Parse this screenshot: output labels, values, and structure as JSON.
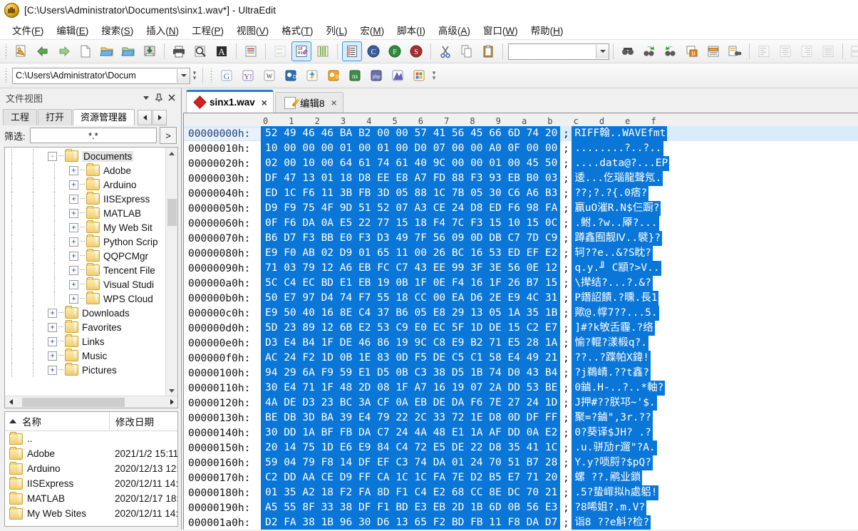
{
  "window": {
    "title": "[C:\\Users\\Administrator\\Documents\\sinx1.wav*] - UltraEdit",
    "app_icon": "ultraedit-icon"
  },
  "menubar": [
    {
      "label": "文件(F)"
    },
    {
      "label": "编辑(E)"
    },
    {
      "label": "搜索(S)"
    },
    {
      "label": "插入(N)"
    },
    {
      "label": "工程(P)"
    },
    {
      "label": "视图(V)"
    },
    {
      "label": "格式(T)"
    },
    {
      "label": "列(L)"
    },
    {
      "label": "宏(M)"
    },
    {
      "label": "脚本(I)"
    },
    {
      "label": "高级(A)"
    },
    {
      "label": "窗口(W)"
    },
    {
      "label": "帮助(H)"
    }
  ],
  "toolbar": {
    "path_combo_value": "C:\\Users\\Administrator\\Docum",
    "icons": [
      "open-recent-icon",
      "back-arrow-icon",
      "forward-arrow-icon",
      "new-file-icon",
      "open-folder-icon",
      "open-project-icon",
      "save-icon",
      "print-icon",
      "print-preview-icon",
      "font-icon",
      "wordwrap-icon",
      "indent-icon",
      "hex-edit-icon",
      "column-mode-icon",
      "list-lines-icon",
      "uc-icon",
      "uf-icon",
      "us-icon",
      "cut-icon",
      "copy-icon",
      "paste-icon",
      "find-icon",
      "find-prev-icon",
      "find-next-icon",
      "bookmark-icon",
      "highlight-icon",
      "find-in-files-icon",
      "align-left-icon",
      "align-center-icon",
      "align-right-icon",
      "justify-icon",
      "compare-icon",
      "split-window-icon",
      "cascade-icon"
    ],
    "web_icons": [
      "google-icon",
      "yahoo-icon",
      "wikipedia-icon",
      "msdn-icon",
      "wizard-icon",
      "dictionary-icon",
      "ns-icon",
      "php-icon",
      "js-icon",
      "windows-icon"
    ]
  },
  "dock": {
    "title": "文件视图",
    "buttons": [
      "chevron-down-icon",
      "pin-icon",
      "close-icon"
    ],
    "tabs": [
      {
        "label": "工程",
        "selected": false
      },
      {
        "label": "打开",
        "selected": false
      },
      {
        "label": "资源管理器",
        "selected": true
      }
    ],
    "filter": {
      "label": "筛选:",
      "value": "*.*",
      "go_label": ">"
    },
    "tree": [
      {
        "label": "Documents",
        "indent": 3,
        "expander": "-",
        "selected": true
      },
      {
        "label": "Adobe",
        "indent": 4,
        "expander": "+",
        "selected": false
      },
      {
        "label": "Arduino",
        "indent": 4,
        "expander": "+",
        "selected": false
      },
      {
        "label": "IISExpress",
        "indent": 4,
        "expander": "+",
        "selected": false
      },
      {
        "label": "MATLAB",
        "indent": 4,
        "expander": "+",
        "selected": false
      },
      {
        "label": "My Web Sit",
        "indent": 4,
        "expander": "+",
        "selected": false
      },
      {
        "label": "Python Scrip",
        "indent": 4,
        "expander": "+",
        "selected": false
      },
      {
        "label": "QQPCMgr",
        "indent": 4,
        "expander": "+",
        "selected": false
      },
      {
        "label": "Tencent File",
        "indent": 4,
        "expander": "+",
        "selected": false
      },
      {
        "label": "Visual Studi",
        "indent": 4,
        "expander": "+",
        "selected": false
      },
      {
        "label": "WPS Cloud ",
        "indent": 4,
        "expander": "+",
        "selected": false
      },
      {
        "label": "Downloads",
        "indent": 3,
        "expander": "+",
        "selected": false
      },
      {
        "label": "Favorites",
        "indent": 3,
        "expander": "+",
        "selected": false
      },
      {
        "label": "Links",
        "indent": 3,
        "expander": "+",
        "selected": false
      },
      {
        "label": "Music",
        "indent": 3,
        "expander": "+",
        "selected": false
      },
      {
        "label": "Pictures",
        "indent": 3,
        "expander": "+",
        "selected": false
      }
    ],
    "list": {
      "columns": [
        "名称",
        "修改日期"
      ],
      "rows": [
        {
          "name": "..",
          "date": ""
        },
        {
          "name": "Adobe",
          "date": "2021/1/2 15:11..."
        },
        {
          "name": "Arduino",
          "date": "2020/12/13 12:..."
        },
        {
          "name": "IISExpress",
          "date": "2020/12/11 14:..."
        },
        {
          "name": "MATLAB",
          "date": "2020/12/17 18:..."
        },
        {
          "name": "My Web Sites",
          "date": "2020/12/11 14:..."
        }
      ]
    }
  },
  "editor": {
    "tabs": [
      {
        "label": "sinx1.wav",
        "icon": "wav-file-icon",
        "selected": true,
        "close": "×"
      },
      {
        "label": "编辑8",
        "icon": "text-file-icon",
        "selected": false,
        "close": "×"
      }
    ],
    "ruler": [
      "0",
      "1",
      "2",
      "3",
      "4",
      "5",
      "6",
      "7",
      "8",
      "9",
      "a",
      "b",
      "c",
      "d",
      "e",
      "f"
    ],
    "separator": ";",
    "rows": [
      {
        "offset": "00000000h:",
        "bytes": "52 49 46 46 BA B2 00 00 57 41 56 45 66 6D 74 20",
        "ascii": "RIFF翰..WAVEfmt"
      },
      {
        "offset": "00000010h:",
        "bytes": "10 00 00 00 01 00 01 00 D0 07 00 00 A0 0F 00 00",
        "ascii": "........?..?.."
      },
      {
        "offset": "00000020h:",
        "bytes": "02 00 10 00 64 61 74 61 40 9C 00 00 01 00 45 50",
        "ascii": "....data@?...EP"
      },
      {
        "offset": "00000030h:",
        "bytes": "DF 47 13 01 18 D8 EE E8 A7 FD 88 F3 93 EB B0 03",
        "ascii": "逶...仡瑙龍聲氖."
      },
      {
        "offset": "00000040h:",
        "bytes": "ED 1C F6 11 3B FB 3D 05 88 1C 7B 05 30 C6 A6 B3",
        "ascii": "??;?.?{.0痞?"
      },
      {
        "offset": "00000050h:",
        "bytes": "D9 F9 75 4F 9D 51 52 07 A3 CE 24 D8 ED F6 98 FA",
        "ascii": "赢uO漼R.N$仨蹰?"
      },
      {
        "offset": "00000060h:",
        "bytes": "0F F6 DA 0A E5 22 77 15 18 F4 7C F3 15 10 15 0C",
        "ascii": ".鲋.?w..厣?..."
      },
      {
        "offset": "00000070h:",
        "bytes": "B6 D7 F3 BB E0 F3 D3 49 7F 56 09 0D DB C7 7D C9",
        "ascii": "蹲鑫囿靓Ⅳ..襞}?"
      },
      {
        "offset": "00000080h:",
        "bytes": "E9 F0 AB 02 D9 01 65 11 00 26 BC 16 53 ED EF E2",
        "ascii": "轲??e..&?S眈?"
      },
      {
        "offset": "00000090h:",
        "bytes": "71 03 79 12 A6 EB FC C7 43 EE 99 3F 3E 56 0E 12",
        "ascii": "q.y.╜  C顓?>V.."
      },
      {
        "offset": "000000a0h:",
        "bytes": "5C C4 EC BD E1 EB 19 0B 1F 0E F4 16 1F 26 B7 15",
        "ascii": "\\撵结?...?.&?"
      },
      {
        "offset": "000000b0h:",
        "bytes": "50 E7 97 D4 74 F7 55 18 CC 00 EA D6 2E E9 4C 31",
        "ascii": "P鐕詔饋.?曛.長1"
      },
      {
        "offset": "000000c0h:",
        "bytes": "E9 50 40 16 8E C4 37 B6 05 E8 29 13 05 1A 35 1B",
        "ascii": "歟@.幥7??...5."
      },
      {
        "offset": "000000d0h:",
        "bytes": "5D 23 89 12 6B E2 53 C9 E0 EC 5F 1D DE 15 C2 E7",
        "ascii": "]#?k敂舌霾.?络"
      },
      {
        "offset": "000000e0h:",
        "bytes": "D3 E4 B4 1F DE 46 86 19 9C C8 E9 B2 71 E5 28 1A",
        "ascii": "愉?輥?漾椴q?."
      },
      {
        "offset": "000000f0h:",
        "bytes": "AC 24 F2 1D 0B 1E 83 0D F5 DE C5 C1 58 E4 49 21",
        "ascii": "??..?蹀帕X鍏!"
      },
      {
        "offset": "00000100h:",
        "bytes": "94 29 6A F9 59 E1 D5 0B C3 38 D5 1B 74 D0 43 B4",
        "ascii": "?j鵜崝.??t鑫?"
      },
      {
        "offset": "00000110h:",
        "bytes": "30 E4 71 1F 48 2D 08 1F A7 16 19 07 2A DD 53 BE",
        "ascii": "0鏀.H-..?..*軸?"
      },
      {
        "offset": "00000120h:",
        "bytes": "4A DE D3 23 BC 3A CF 0A EB DE DA F6 7E 27 24 1D",
        "ascii": "J押#??朕邛~'$."
      },
      {
        "offset": "00000130h:",
        "bytes": "BE DB 3D BA 39 E4 79 22 2C 33 72 1E D8 0D DF FF",
        "ascii": "聚=?鏀\",3r.??"
      },
      {
        "offset": "00000140h:",
        "bytes": "30 DD 1A BF FB DA C7 24 4A 48 E1 1A AF DD 0A E2",
        "ascii": "0?葵译$JH?  .?"
      },
      {
        "offset": "00000150h:",
        "bytes": "20 14 75 1D E6 E9 84 C4 72 E5 DE 22 D8 35 41 1C",
        "ascii": " .u.骈劢r遛\"?A."
      },
      {
        "offset": "00000160h:",
        "bytes": "59 04 79 F8 14 DF EF C3 74 DA 01 24 70 51 B7 28",
        "ascii": "Y.y?唢脟?$pQ?"
      },
      {
        "offset": "00000170h:",
        "bytes": "C2 DD AA CE D9 FF CA 1C 1C FA 7E D2 B5 E7 71 20",
        "ascii": "螺  ??.鹇业鎖"
      },
      {
        "offset": "00000180h:",
        "bytes": "01 35 A2 18 F2 FA 8D F1 C4 E2 68 CC 8E DC 70 21",
        "ascii": ".5?蛰嶵拟h處躳!"
      },
      {
        "offset": "00000190h:",
        "bytes": "A5 55 8F 33 38 DF F1 BD E3 EB 2D 1B 6D 0B 56 E3",
        "ascii": "  ?8唏姐?.m.V?"
      },
      {
        "offset": "000001a0h:",
        "bytes": "D2 FA 38 1B 96 30 D6 13 65 F2 BD FB 11 F8 DA D7",
        "ascii": "诣8 ??e斛?检?"
      }
    ]
  },
  "colors": {
    "selection_bg": "#0a76d8",
    "selection_fg": "#ffffff",
    "accent_tab": "#2b7bd4",
    "row_highlight": "#d9ecfb"
  }
}
